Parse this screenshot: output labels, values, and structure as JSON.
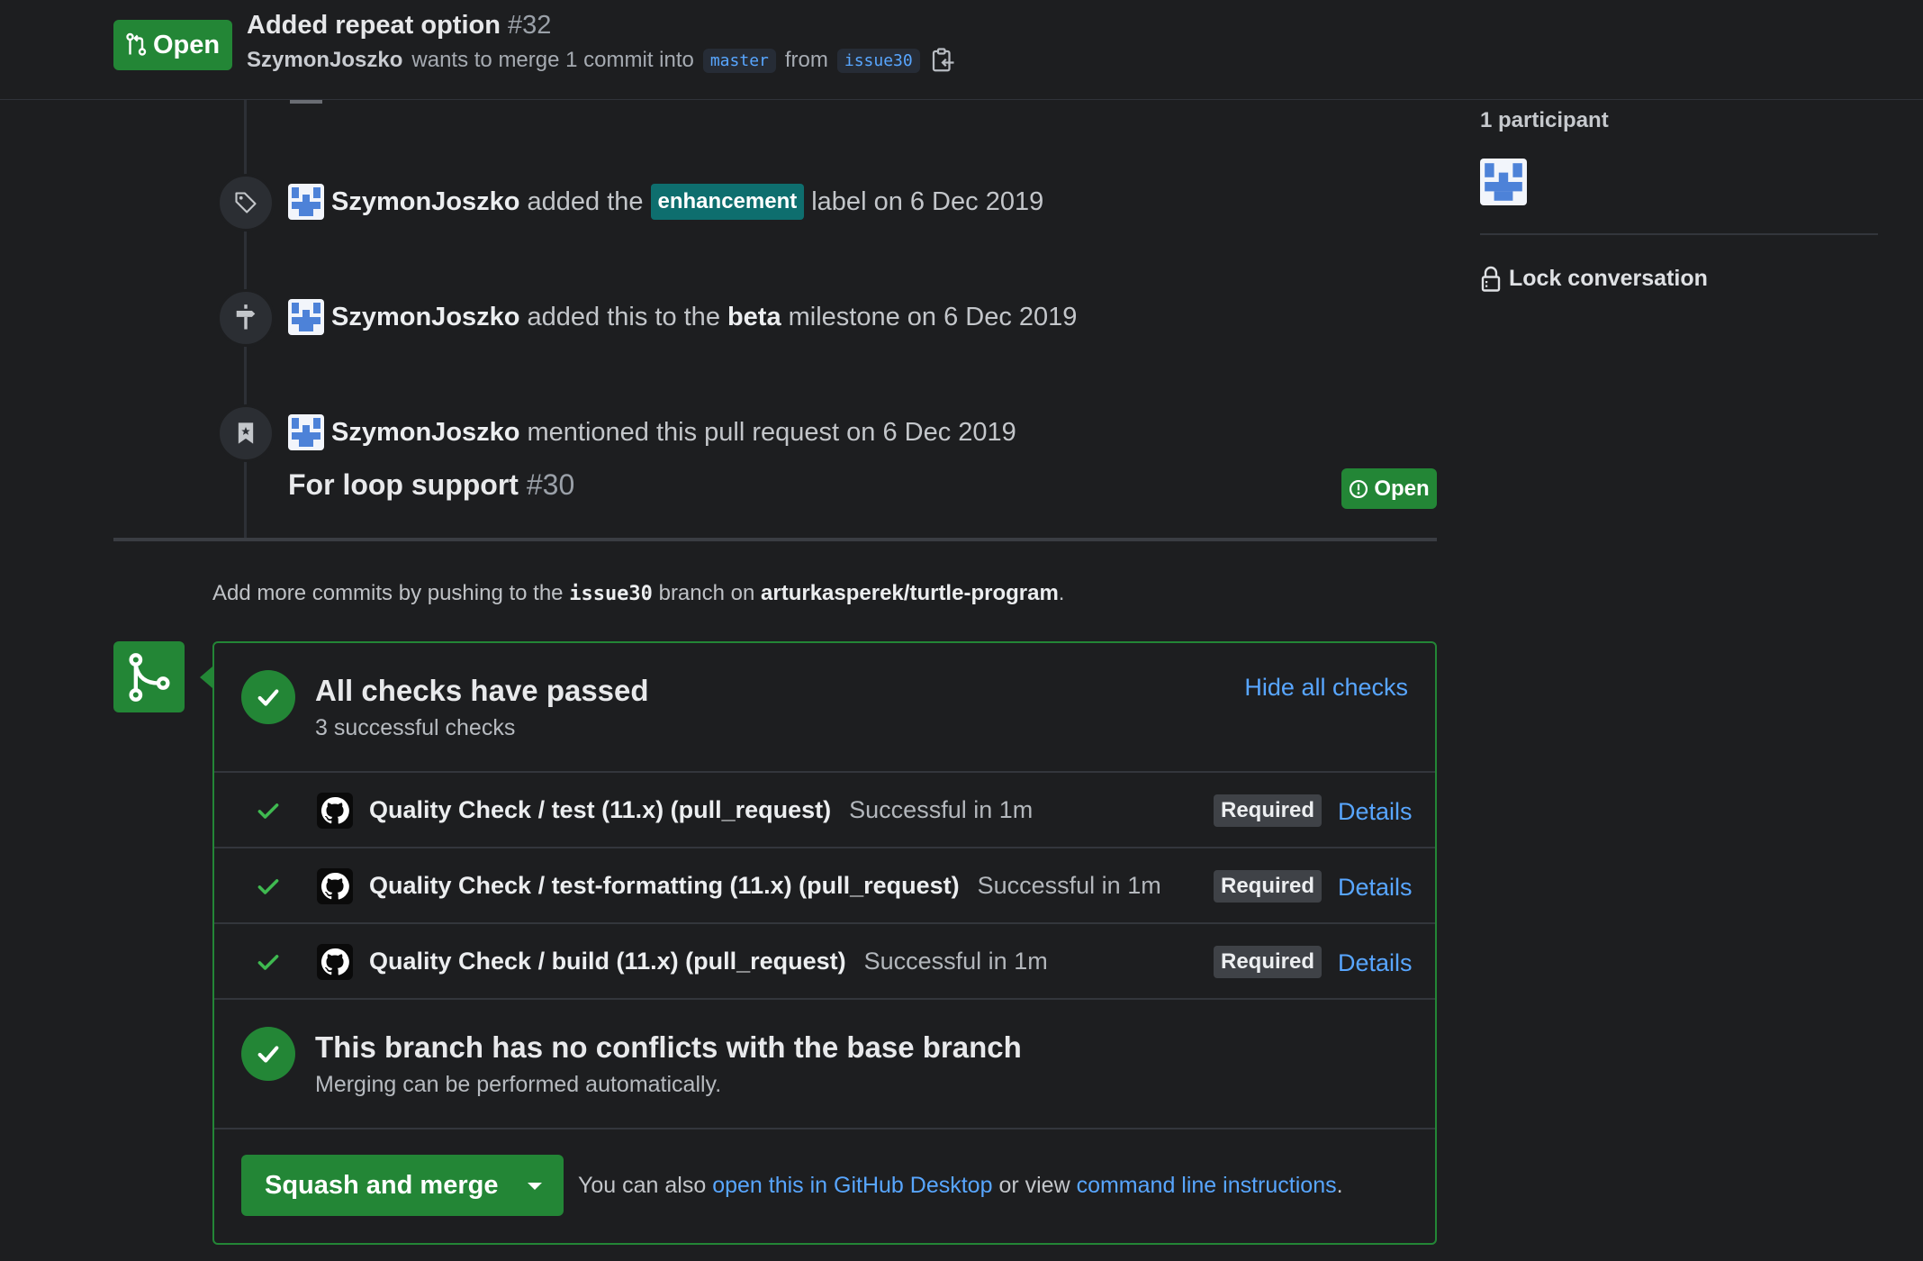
{
  "header": {
    "state": "Open",
    "title": "Added repeat option",
    "number": "#32",
    "author": "SzymonJoszko",
    "merge_text": "wants to merge 1 commit into",
    "base_branch": "master",
    "from_text": "from",
    "head_branch": "issue30"
  },
  "events": [
    {
      "actor": "SzymonJoszko",
      "pre": "added the",
      "label": "enhancement",
      "post": "label on 6 Dec 2019",
      "icon": "tag-icon"
    },
    {
      "actor": "SzymonJoszko",
      "pre": "added this to the",
      "milestone": "beta",
      "post": "milestone on 6 Dec 2019",
      "icon": "milestone-icon"
    },
    {
      "actor": "SzymonJoszko",
      "text": "mentioned this pull request on 6 Dec 2019",
      "icon": "bookmark-icon",
      "ref_title": "For loop support",
      "ref_number": "#30",
      "ref_state": "Open"
    }
  ],
  "push_hint": {
    "pre": "Add more commits by pushing to the",
    "branch": "issue30",
    "mid": "branch on",
    "repo": "arturkasperek/turtle-program",
    "end": "."
  },
  "checks": {
    "title": "All checks have passed",
    "subtitle": "3 successful checks",
    "toggle": "Hide all checks",
    "items": [
      {
        "name": "Quality Check / test (11.x) (pull_request)",
        "status": "Successful in 1m",
        "badge": "Required",
        "link": "Details"
      },
      {
        "name": "Quality Check / test-formatting (11.x) (pull_request)",
        "status": "Successful in 1m",
        "badge": "Required",
        "link": "Details"
      },
      {
        "name": "Quality Check / build (11.x) (pull_request)",
        "status": "Successful in 1m",
        "badge": "Required",
        "link": "Details"
      }
    ]
  },
  "conflicts": {
    "title": "This branch has no conflicts with the base branch",
    "subtitle": "Merging can be performed automatically."
  },
  "merge": {
    "button": "Squash and merge",
    "alt_pre": "You can also",
    "desktop_link": "open this in GitHub Desktop",
    "alt_mid": "or view",
    "cli_link": "command line instructions",
    "alt_end": "."
  },
  "sidebar": {
    "participants": "1 participant",
    "lock": "Lock conversation"
  },
  "colors": {
    "success": "#238636",
    "link": "#58a6ff",
    "background": "#1d1e20",
    "label_enhancement": "#0e6e6e"
  }
}
